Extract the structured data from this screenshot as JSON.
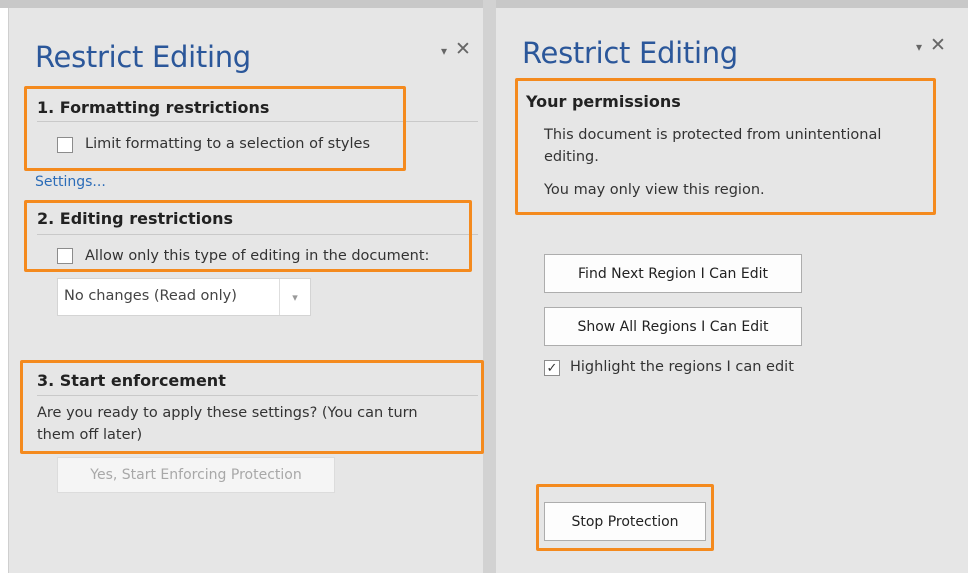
{
  "left_pane": {
    "title": "Restrict Editing",
    "section1": {
      "heading": "1. Formatting restrictions",
      "checkbox_label": "Limit formatting to a selection of styles",
      "settings_link": "Settings..."
    },
    "section2": {
      "heading": "2. Editing restrictions",
      "checkbox_label": "Allow only this type of editing in the document:",
      "dropdown_value": "No changes (Read only)"
    },
    "section3": {
      "heading": "3. Start enforcement",
      "line1": "Are you ready to apply these settings? (You can turn",
      "line2": "them off later)",
      "button": "Yes, Start Enforcing Protection"
    }
  },
  "right_pane": {
    "title": "Restrict Editing",
    "permissions": {
      "heading": "Your permissions",
      "line1": "This document is protected from unintentional",
      "line2": "editing.",
      "line3": "You may only view this region."
    },
    "find_next_button": "Find Next Region I Can Edit",
    "show_all_button": "Show All Regions I Can Edit",
    "highlight_label": "Highlight the regions I can edit",
    "highlight_checked": true,
    "stop_button": "Stop Protection"
  },
  "pane_controls": {
    "dropdown_icon": "▾",
    "close_icon": "✕"
  },
  "colors": {
    "title": "#2b579a",
    "highlight": "#f48a1e",
    "link": "#2b6cb8",
    "pane_bg": "#e6e6e6"
  }
}
